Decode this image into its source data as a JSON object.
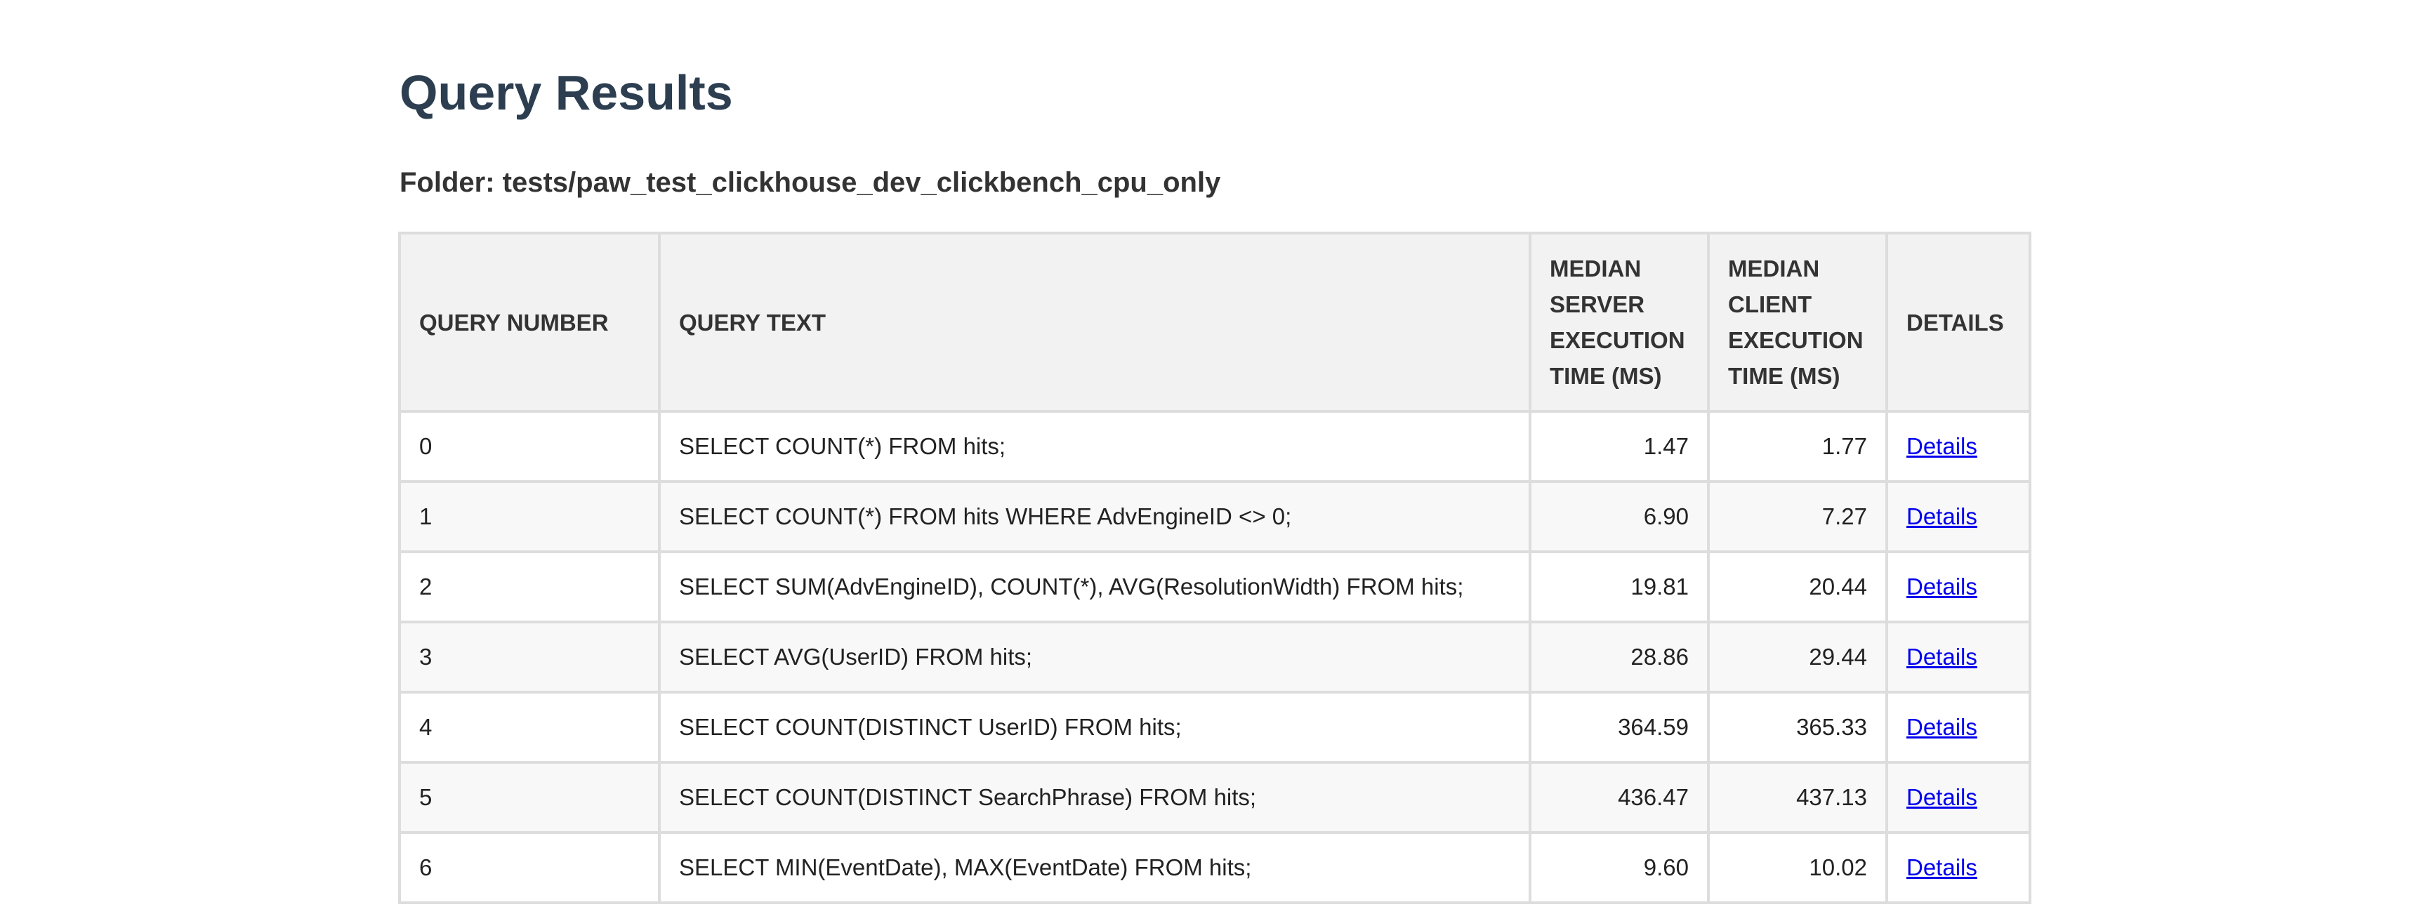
{
  "page": {
    "title": "Query Results",
    "folder": "Folder: tests/paw_test_clickhouse_dev_clickbench_cpu_only"
  },
  "table": {
    "headers": {
      "query_number": "QUERY NUMBER",
      "query_text": "QUERY TEXT",
      "median_server": "MEDIAN SERVER EXECUTION TIME (MS)",
      "median_client": "MEDIAN CLIENT EXECUTION TIME (MS)",
      "details": "DETAILS"
    },
    "rows": [
      {
        "number": "0",
        "text": "SELECT COUNT(*) FROM hits;",
        "server": "1.47",
        "client": "1.77",
        "details": "Details"
      },
      {
        "number": "1",
        "text": "SELECT COUNT(*) FROM hits WHERE AdvEngineID <> 0;",
        "server": "6.90",
        "client": "7.27",
        "details": "Details"
      },
      {
        "number": "2",
        "text": "SELECT SUM(AdvEngineID), COUNT(*), AVG(ResolutionWidth) FROM hits;",
        "server": "19.81",
        "client": "20.44",
        "details": "Details"
      },
      {
        "number": "3",
        "text": "SELECT AVG(UserID) FROM hits;",
        "server": "28.86",
        "client": "29.44",
        "details": "Details"
      },
      {
        "number": "4",
        "text": "SELECT COUNT(DISTINCT UserID) FROM hits;",
        "server": "364.59",
        "client": "365.33",
        "details": "Details"
      },
      {
        "number": "5",
        "text": "SELECT COUNT(DISTINCT SearchPhrase) FROM hits;",
        "server": "436.47",
        "client": "437.13",
        "details": "Details"
      },
      {
        "number": "6",
        "text": "SELECT MIN(EventDate), MAX(EventDate) FROM hits;",
        "server": "9.60",
        "client": "10.02",
        "details": "Details"
      }
    ]
  }
}
